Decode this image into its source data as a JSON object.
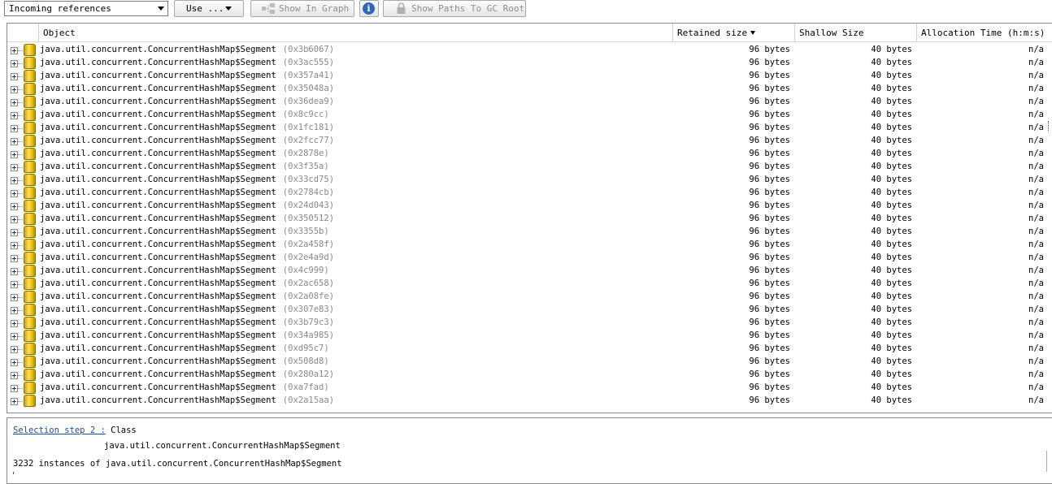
{
  "toolbar": {
    "view_select": "Incoming references",
    "use_button": "Use ...",
    "show_in_graph": "Show In Graph",
    "show_paths": "Show Paths To GC Root"
  },
  "table": {
    "columns": [
      "Object",
      "Retained size",
      "Shallow Size",
      "Allocation Time (h:m:s)"
    ],
    "rows": [
      {
        "object": "java.util.concurrent.ConcurrentHashMap$Segment",
        "addr": "(0x3b6067)",
        "retained": "96 bytes",
        "shallow": "40 bytes",
        "alloc": "n/a"
      },
      {
        "object": "java.util.concurrent.ConcurrentHashMap$Segment",
        "addr": "(0x3ac555)",
        "retained": "96 bytes",
        "shallow": "40 bytes",
        "alloc": "n/a"
      },
      {
        "object": "java.util.concurrent.ConcurrentHashMap$Segment",
        "addr": "(0x357a41)",
        "retained": "96 bytes",
        "shallow": "40 bytes",
        "alloc": "n/a"
      },
      {
        "object": "java.util.concurrent.ConcurrentHashMap$Segment",
        "addr": "(0x35048a)",
        "retained": "96 bytes",
        "shallow": "40 bytes",
        "alloc": "n/a"
      },
      {
        "object": "java.util.concurrent.ConcurrentHashMap$Segment",
        "addr": "(0x36dea9)",
        "retained": "96 bytes",
        "shallow": "40 bytes",
        "alloc": "n/a"
      },
      {
        "object": "java.util.concurrent.ConcurrentHashMap$Segment",
        "addr": "(0x8c9cc)",
        "retained": "96 bytes",
        "shallow": "40 bytes",
        "alloc": "n/a"
      },
      {
        "object": "java.util.concurrent.ConcurrentHashMap$Segment",
        "addr": "(0x1fc181)",
        "retained": "96 bytes",
        "shallow": "40 bytes",
        "alloc": "n/a"
      },
      {
        "object": "java.util.concurrent.ConcurrentHashMap$Segment",
        "addr": "(0x2fcc77)",
        "retained": "96 bytes",
        "shallow": "40 bytes",
        "alloc": "n/a"
      },
      {
        "object": "java.util.concurrent.ConcurrentHashMap$Segment",
        "addr": "(0x2878e)",
        "retained": "96 bytes",
        "shallow": "40 bytes",
        "alloc": "n/a"
      },
      {
        "object": "java.util.concurrent.ConcurrentHashMap$Segment",
        "addr": "(0x3f35a)",
        "retained": "96 bytes",
        "shallow": "40 bytes",
        "alloc": "n/a"
      },
      {
        "object": "java.util.concurrent.ConcurrentHashMap$Segment",
        "addr": "(0x33cd75)",
        "retained": "96 bytes",
        "shallow": "40 bytes",
        "alloc": "n/a"
      },
      {
        "object": "java.util.concurrent.ConcurrentHashMap$Segment",
        "addr": "(0x2784cb)",
        "retained": "96 bytes",
        "shallow": "40 bytes",
        "alloc": "n/a"
      },
      {
        "object": "java.util.concurrent.ConcurrentHashMap$Segment",
        "addr": "(0x24d043)",
        "retained": "96 bytes",
        "shallow": "40 bytes",
        "alloc": "n/a"
      },
      {
        "object": "java.util.concurrent.ConcurrentHashMap$Segment",
        "addr": "(0x350512)",
        "retained": "96 bytes",
        "shallow": "40 bytes",
        "alloc": "n/a"
      },
      {
        "object": "java.util.concurrent.ConcurrentHashMap$Segment",
        "addr": "(0x3355b)",
        "retained": "96 bytes",
        "shallow": "40 bytes",
        "alloc": "n/a"
      },
      {
        "object": "java.util.concurrent.ConcurrentHashMap$Segment",
        "addr": "(0x2a458f)",
        "retained": "96 bytes",
        "shallow": "40 bytes",
        "alloc": "n/a"
      },
      {
        "object": "java.util.concurrent.ConcurrentHashMap$Segment",
        "addr": "(0x2e4a9d)",
        "retained": "96 bytes",
        "shallow": "40 bytes",
        "alloc": "n/a"
      },
      {
        "object": "java.util.concurrent.ConcurrentHashMap$Segment",
        "addr": "(0x4c999)",
        "retained": "96 bytes",
        "shallow": "40 bytes",
        "alloc": "n/a"
      },
      {
        "object": "java.util.concurrent.ConcurrentHashMap$Segment",
        "addr": "(0x2ac658)",
        "retained": "96 bytes",
        "shallow": "40 bytes",
        "alloc": "n/a"
      },
      {
        "object": "java.util.concurrent.ConcurrentHashMap$Segment",
        "addr": "(0x2a08fe)",
        "retained": "96 bytes",
        "shallow": "40 bytes",
        "alloc": "n/a"
      },
      {
        "object": "java.util.concurrent.ConcurrentHashMap$Segment",
        "addr": "(0x307e83)",
        "retained": "96 bytes",
        "shallow": "40 bytes",
        "alloc": "n/a"
      },
      {
        "object": "java.util.concurrent.ConcurrentHashMap$Segment",
        "addr": "(0x3b79c3)",
        "retained": "96 bytes",
        "shallow": "40 bytes",
        "alloc": "n/a"
      },
      {
        "object": "java.util.concurrent.ConcurrentHashMap$Segment",
        "addr": "(0x34a985)",
        "retained": "96 bytes",
        "shallow": "40 bytes",
        "alloc": "n/a"
      },
      {
        "object": "java.util.concurrent.ConcurrentHashMap$Segment",
        "addr": "(0xd95c7)",
        "retained": "96 bytes",
        "shallow": "40 bytes",
        "alloc": "n/a"
      },
      {
        "object": "java.util.concurrent.ConcurrentHashMap$Segment",
        "addr": "(0x508d8)",
        "retained": "96 bytes",
        "shallow": "40 bytes",
        "alloc": "n/a"
      },
      {
        "object": "java.util.concurrent.ConcurrentHashMap$Segment",
        "addr": "(0x280a12)",
        "retained": "96 bytes",
        "shallow": "40 bytes",
        "alloc": "n/a"
      },
      {
        "object": "java.util.concurrent.ConcurrentHashMap$Segment",
        "addr": "(0xa7fad)",
        "retained": "96 bytes",
        "shallow": "40 bytes",
        "alloc": "n/a"
      },
      {
        "object": "java.util.concurrent.ConcurrentHashMap$Segment",
        "addr": "(0x2a15aa)",
        "retained": "96 bytes",
        "shallow": "40 bytes",
        "alloc": "n/a"
      }
    ]
  },
  "info": {
    "selection_link": "Selection step 2 :",
    "selection_kind": "Class",
    "class_name": "java.util.concurrent.ConcurrentHashMap$Segment",
    "instances": "3232 instances of java.util.concurrent.ConcurrentHashMap$Segment"
  }
}
